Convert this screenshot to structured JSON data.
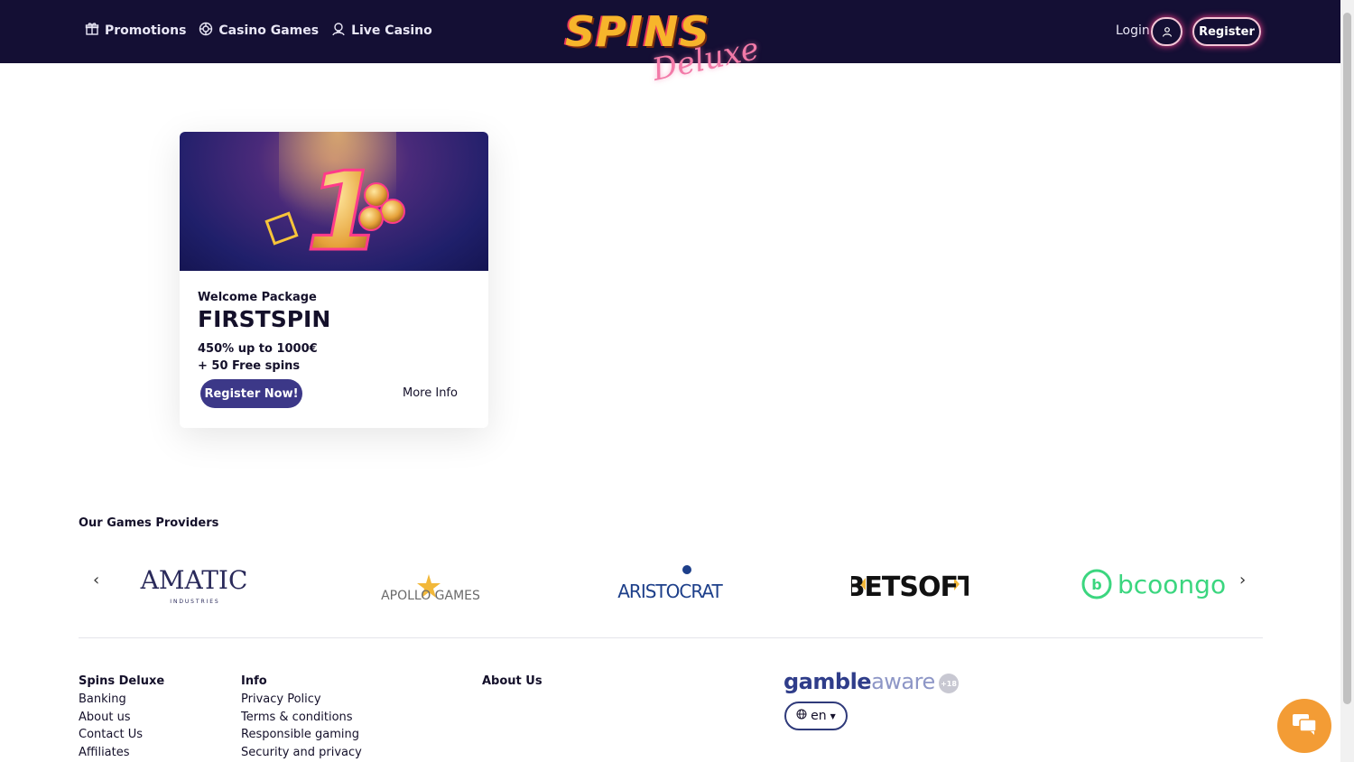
{
  "header": {
    "nav": [
      {
        "label": "Promotions",
        "icon": "gift-icon"
      },
      {
        "label": "Casino Games",
        "icon": "chip-icon"
      },
      {
        "label": "Live Casino",
        "icon": "dealer-icon"
      }
    ],
    "logo": {
      "primary": "SPINS",
      "secondary": "Deluxe"
    },
    "login_label": "Login",
    "register_label": "Register",
    "accent_color": "#ff3b8a",
    "bar_color": "#140f34"
  },
  "promo": {
    "package_label": "Welcome Package",
    "code": "FIRSTSPIN",
    "line1": "450% up to 1000€",
    "line2": "+ 50 Free spins",
    "register_now": "Register Now!",
    "more_info": "More Info",
    "banner_number": "1"
  },
  "providers": {
    "title": "Our Games Providers",
    "prev_arrow": "‹",
    "next_arrow": "›",
    "items": [
      {
        "name": "AMATIC",
        "sub": "I N D U S T R I E S"
      },
      {
        "name": "APOLLO GAMES"
      },
      {
        "name": "ARISTOCRAT"
      },
      {
        "name": "BETSOFT"
      },
      {
        "name": "bcoongo"
      }
    ]
  },
  "footer": {
    "col1": {
      "head": "Spins Deluxe",
      "links": [
        "Banking",
        "About us",
        "Contact Us",
        "Affiliates"
      ]
    },
    "col2": {
      "head": "Info",
      "links": [
        "Privacy Policy",
        "Terms & conditions",
        "Responsible gaming",
        "Security and privacy"
      ]
    },
    "col3": {
      "head": "About Us"
    },
    "gamble_part1": "gamble",
    "gamble_part2": "aware",
    "age_badge": "+18",
    "language": "en"
  }
}
